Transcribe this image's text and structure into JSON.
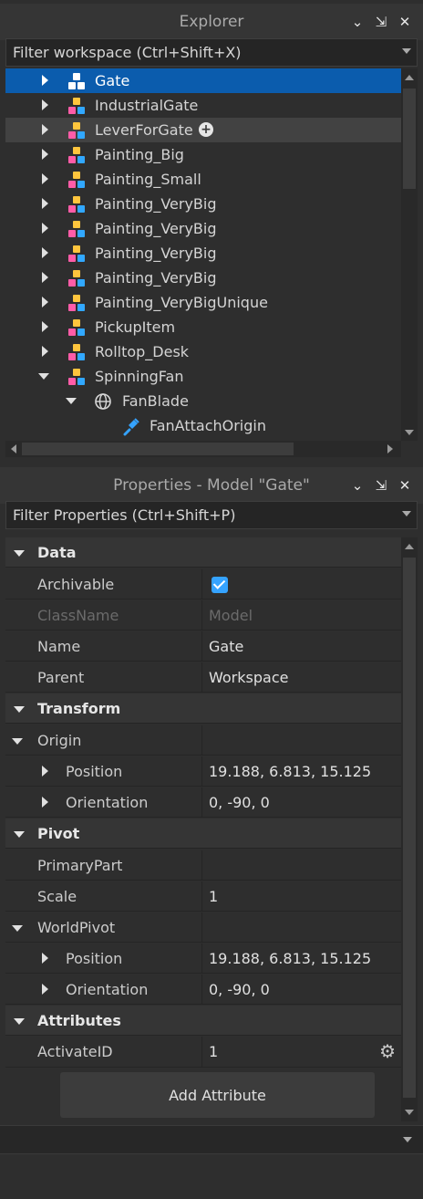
{
  "explorer": {
    "title": "Explorer",
    "filter_placeholder": "Filter workspace (Ctrl+Shift+X)",
    "items": [
      {
        "label": "Gate",
        "icon": "model-icon",
        "state": "selected"
      },
      {
        "label": "IndustrialGate",
        "icon": "model-icon"
      },
      {
        "label": "LeverForGate",
        "icon": "model-icon",
        "state": "hover"
      },
      {
        "label": "Painting_Big",
        "icon": "model-icon"
      },
      {
        "label": "Painting_Small",
        "icon": "model-icon"
      },
      {
        "label": "Painting_VeryBig",
        "icon": "model-icon"
      },
      {
        "label": "Painting_VeryBig",
        "icon": "model-icon"
      },
      {
        "label": "Painting_VeryBig",
        "icon": "model-icon"
      },
      {
        "label": "Painting_VeryBig",
        "icon": "model-icon"
      },
      {
        "label": "Painting_VeryBigUnique",
        "icon": "model-icon"
      },
      {
        "label": "PickupItem",
        "icon": "model-icon"
      },
      {
        "label": "Rolltop_Desk",
        "icon": "model-icon"
      },
      {
        "label": "SpinningFan",
        "icon": "model-icon",
        "expanded": true
      },
      {
        "label": "FanBlade",
        "icon": "mesh-globe-icon",
        "expanded": true
      },
      {
        "label": "FanAttachOrigin",
        "icon": "attachment-icon"
      }
    ]
  },
  "properties": {
    "title": "Properties - Model \"Gate\"",
    "filter_placeholder": "Filter Properties (Ctrl+Shift+P)",
    "categories": {
      "data": "Data",
      "transform": "Transform",
      "pivot": "Pivot",
      "attributes": "Attributes"
    },
    "rows": {
      "archivable": {
        "name": "Archivable",
        "value": true
      },
      "classname": {
        "name": "ClassName",
        "value": "Model"
      },
      "name": {
        "name": "Name",
        "value": "Gate"
      },
      "parent": {
        "name": "Parent",
        "value": "Workspace"
      },
      "origin": {
        "name": "Origin"
      },
      "origin_position": {
        "name": "Position",
        "value": "19.188, 6.813, 15.125"
      },
      "origin_orientation": {
        "name": "Orientation",
        "value": "0, -90, 0"
      },
      "primarypart": {
        "name": "PrimaryPart",
        "value": ""
      },
      "scale": {
        "name": "Scale",
        "value": "1"
      },
      "worldpivot": {
        "name": "WorldPivot"
      },
      "worldpivot_position": {
        "name": "Position",
        "value": "19.188, 6.813, 15.125"
      },
      "worldpivot_orientation": {
        "name": "Orientation",
        "value": "0, -90, 0"
      },
      "activateid": {
        "name": "ActivateID",
        "value": "1"
      }
    },
    "add_attribute_label": "Add Attribute"
  },
  "colors": {
    "selection": "#0b5cad",
    "accent": "#35a3ff"
  }
}
